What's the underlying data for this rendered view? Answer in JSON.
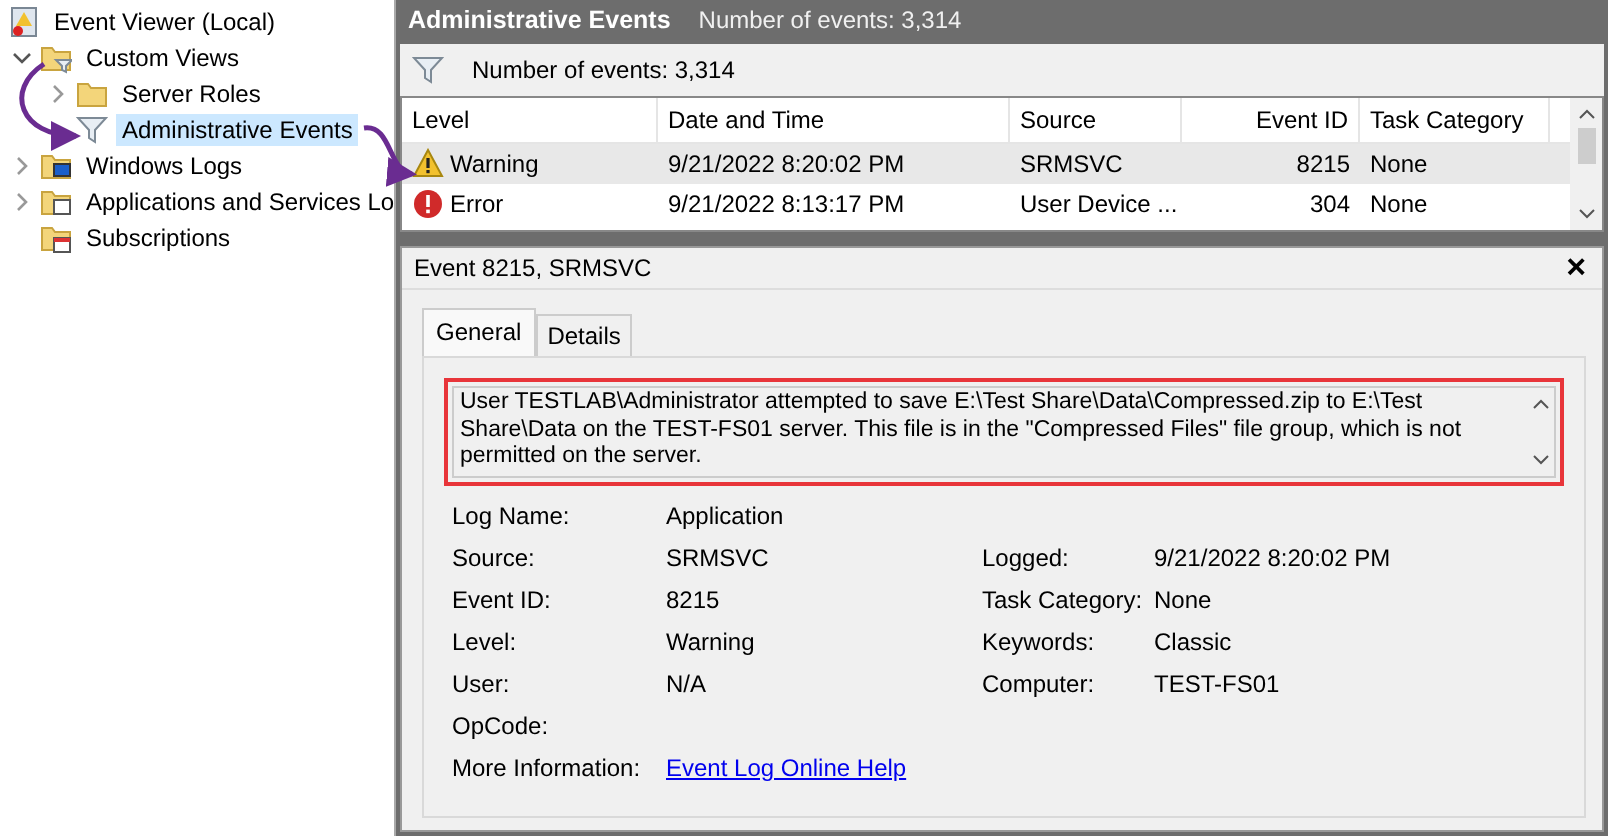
{
  "tree": {
    "root": {
      "label": "Event Viewer (Local)"
    },
    "items": [
      {
        "label": "Custom Views",
        "kind": "filter-folder",
        "expanded": true,
        "selected": false,
        "children": [
          {
            "label": "Server Roles",
            "kind": "folder",
            "expanded": false,
            "selected": false
          },
          {
            "label": "Administrative Events",
            "kind": "filter",
            "selected": true
          }
        ]
      },
      {
        "label": "Windows Logs",
        "kind": "monitor-folder",
        "expanded": false,
        "selected": false
      },
      {
        "label": "Applications and Services Lo",
        "kind": "window-folder",
        "expanded": false,
        "selected": false
      },
      {
        "label": "Subscriptions",
        "kind": "calendar-folder",
        "selected": false
      }
    ]
  },
  "header": {
    "title": "Administrative Events",
    "count": "Number of events: 3,314"
  },
  "filter_bar": {
    "text": "Number of events: 3,314"
  },
  "table": {
    "columns": [
      "Level",
      "Date and Time",
      "Source",
      "Event ID",
      "Task Category"
    ],
    "rows": [
      {
        "kind": "warning",
        "selected": true,
        "cells": [
          "Warning",
          "9/21/2022 8:20:02 PM",
          "SRMSVC",
          "8215",
          "None"
        ]
      },
      {
        "kind": "error",
        "selected": false,
        "cells": [
          "Error",
          "9/21/2022 8:13:17 PM",
          "User Device ...",
          "304",
          "None"
        ]
      }
    ]
  },
  "details": {
    "title": "Event 8215, SRMSVC",
    "close": "×",
    "tabs": [
      {
        "label": "General",
        "selected": true
      },
      {
        "label": "Details",
        "selected": false
      }
    ],
    "message": "User TESTLAB\\Administrator attempted to save E:\\Test Share\\Data\\Compressed.zip to E:\\Test Share\\Data on the TEST-FS01 server. This file is in the \"Compressed Files\" file group, which is not permitted on the server.",
    "fields": [
      {
        "label": "Log Name:",
        "value": "Application"
      },
      {
        "label": "Source:",
        "value": "SRMSVC",
        "label2": "Logged:",
        "value2": "9/21/2022 8:20:02 PM"
      },
      {
        "label": "Event ID:",
        "value": "8215",
        "label2": "Task Category:",
        "value2": "None"
      },
      {
        "label": "Level:",
        "value": "Warning",
        "label2": "Keywords:",
        "value2": "Classic"
      },
      {
        "label": "User:",
        "value": "N/A",
        "label2": "Computer:",
        "value2": "TEST-FS01"
      },
      {
        "label": "OpCode:"
      },
      {
        "label": "More Information:",
        "link": "Event Log Online Help"
      }
    ]
  }
}
